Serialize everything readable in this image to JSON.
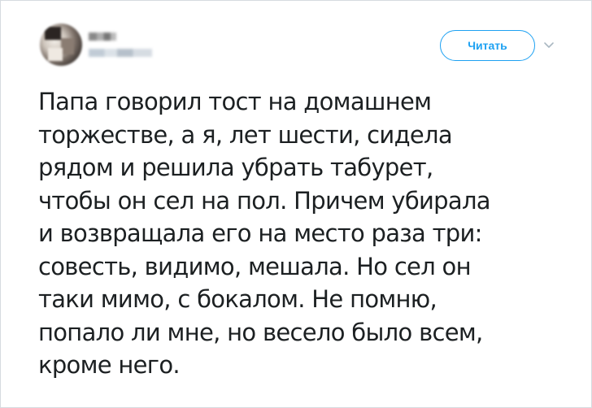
{
  "header": {
    "follow_label": "Читать",
    "icons": {
      "avatar": "blurred-profile-avatar",
      "chevron": "chevron-down-icon"
    }
  },
  "tweet": {
    "lines": [
      "Папа говорил тост на домашнем",
      "торжестве, а я, лет шести, сидела",
      "рядом и решила убрать табурет,",
      "чтобы он сел на пол. Причем убирала",
      "и возвращала его на место раза три:",
      "совесть, видимо, мешала. Но сел он",
      "таки мимо, с бокалом. Не помню,",
      "попало ли мне, но весело было всем,",
      "кроме него."
    ]
  },
  "colors": {
    "accent": "#1da1f2",
    "text": "#1c2022",
    "border": "#d6dbe0",
    "chevron": "#aab8c2"
  }
}
